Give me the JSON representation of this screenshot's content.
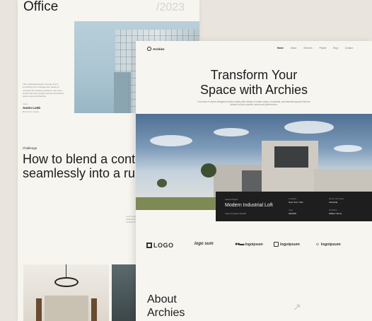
{
  "back_page": {
    "title": "Office",
    "year": "/2023",
    "description": "This residential design concept, lorem something from management design to concepts the industry problems. Get more impact with pure design concept that deliver great unique architecture.",
    "client_label": "Client",
    "client_name": "Aaron Loeb",
    "client_location": "Barcelona, Spain",
    "challenge_label": "Challenge",
    "challenge_text": "How to blend a contemporary design seamlessly into a rural environment.",
    "small_text": "Lorem ipsum dolor sit amet consectetur adipiscing elit sed do eiusmod tempor incididunt ut labore et dolore magna aliqua."
  },
  "front_page": {
    "logo": "Archies",
    "nav": [
      "Home",
      "About",
      "Services",
      "Project",
      "Blog",
      "Contact"
    ],
    "hero_title_line1": "Transform Your",
    "hero_title_line2": "Space with Archies",
    "hero_subtitle": "Our team of expert designers works closely with clients to create unique, functional, and beautiful spaces that are tailored to their specific needs and preferences.",
    "project_card": {
      "label": "Latest Project",
      "name": "Modern Industrial Loft",
      "sub": "View Complete Details",
      "stats": [
        {
          "key": "Location",
          "value": "New York, USA"
        },
        {
          "key": "Name of Project",
          "value": "Industrial"
        },
        {
          "key": "Year",
          "value": "2022/08"
        },
        {
          "key": "Architect",
          "value": "William Stone"
        }
      ]
    },
    "logos": [
      "LOGO",
      "logo sum",
      "logoipsum",
      "logoipsum",
      "logoipsum"
    ],
    "about_line1": "About",
    "about_line2": "Archies"
  },
  "colors": {
    "background": "#e9e5de",
    "page": "#f7f5f0",
    "card": "#1e1e1e",
    "text": "#1c1c1c"
  }
}
